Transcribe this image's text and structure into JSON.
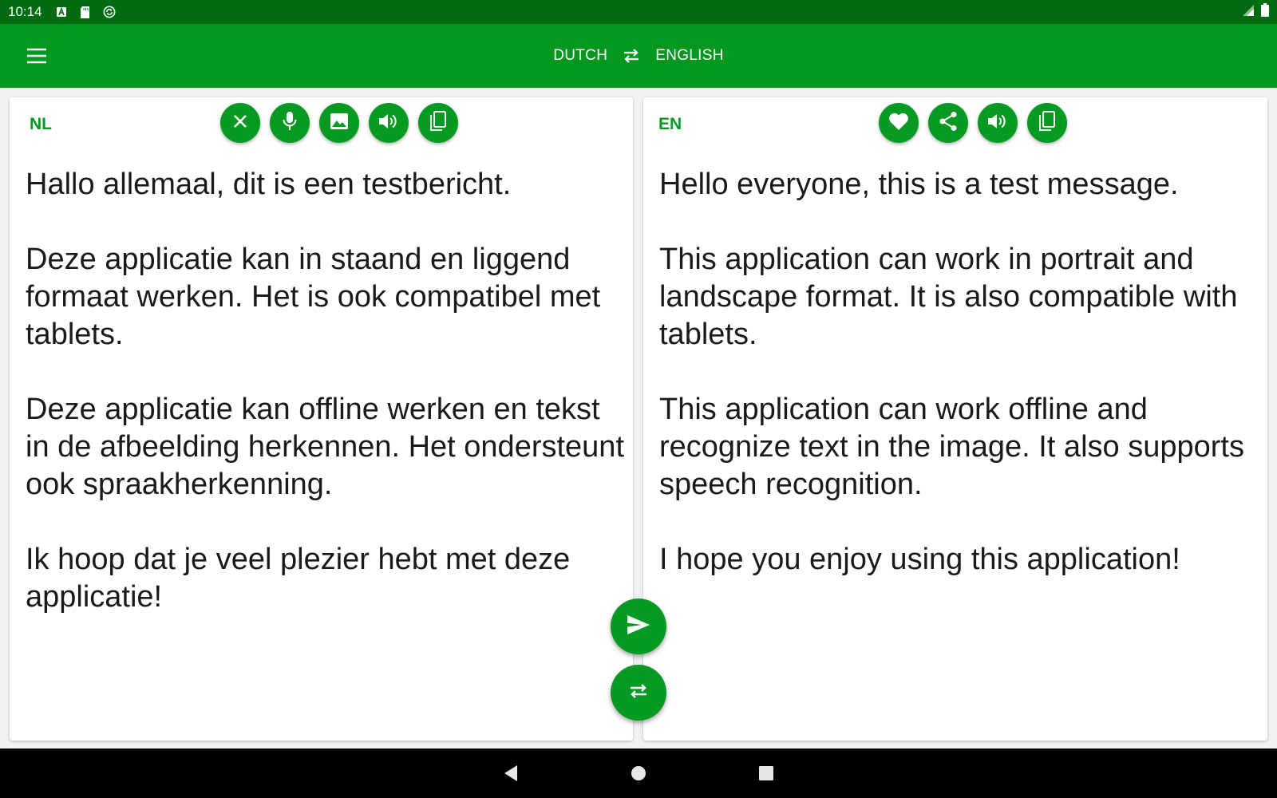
{
  "status_bar": {
    "time": "10:14",
    "icons": [
      "a-box-icon",
      "sd-card-icon",
      "sync-circle-icon",
      "signal-icon",
      "battery-icon"
    ]
  },
  "app_bar": {
    "menu_icon": "hamburger-icon",
    "source_language": "DUTCH",
    "target_language": "ENGLISH",
    "swap_icon": "swap-arrows-icon"
  },
  "source_panel": {
    "code": "NL",
    "tools": [
      "clear-icon",
      "mic-icon",
      "image-icon",
      "speaker-icon",
      "copy-icon"
    ],
    "text": "Hallo allemaal, dit is een testbericht.\n\nDeze applicatie kan in staand en liggend formaat werken. Het is ook compatibel met tablets.\n\nDeze applicatie kan offline werken en tekst in de afbeelding herkennen. Het ondersteunt ook spraakherkenning.\n\nIk hoop dat je veel plezier hebt met deze applicatie!"
  },
  "target_panel": {
    "code": "EN",
    "tools": [
      "heart-icon",
      "share-icon",
      "speaker-icon",
      "copy-icon"
    ],
    "text": "Hello everyone, this is a test message.\n\nThis application can work in portrait and landscape format. It is also compatible with tablets.\n\nThis application can work offline and recognize text in the image. It also supports speech recognition.\n\nI hope you enjoy using this application!"
  },
  "fabs": [
    "send-icon",
    "swap-arrows-icon"
  ],
  "colors": {
    "status_bar": "#006b0f",
    "app_bar": "#05981e",
    "accent": "#079a22"
  }
}
